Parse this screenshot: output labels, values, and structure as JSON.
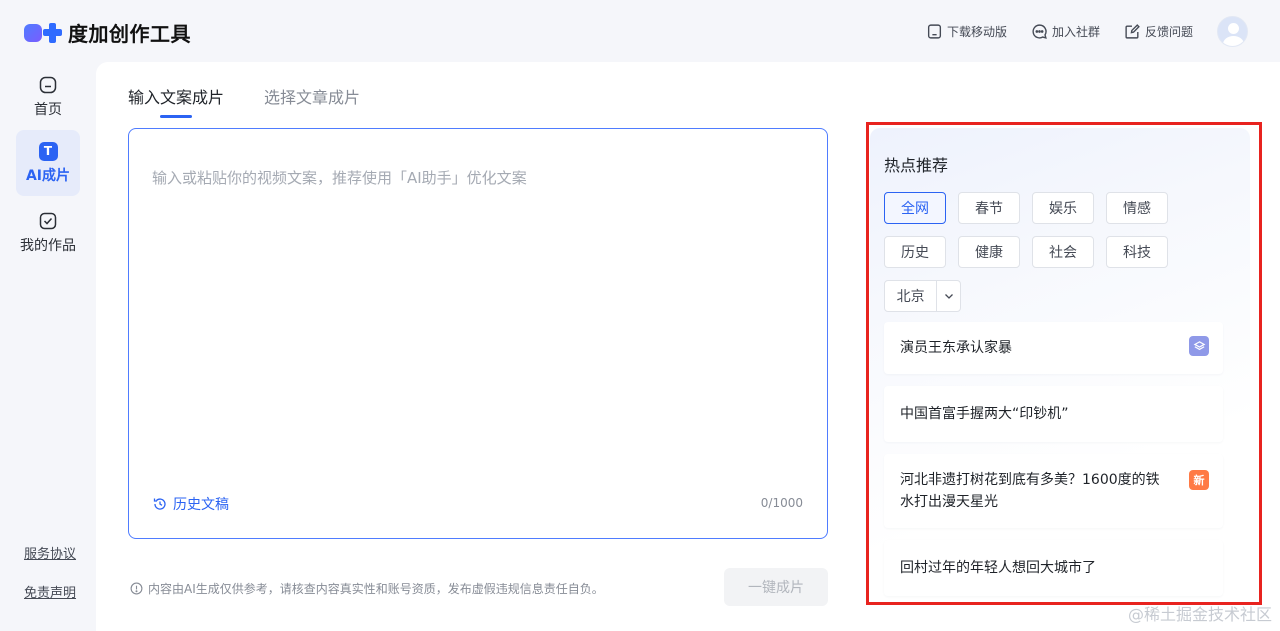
{
  "app": {
    "title": "度加创作工具"
  },
  "header": {
    "actions": [
      {
        "label": "下载移动版",
        "icon": "mobile-icon"
      },
      {
        "label": "加入社群",
        "icon": "chat-icon"
      },
      {
        "label": "反馈问题",
        "icon": "edit-icon"
      }
    ],
    "avatar": "avatar-icon"
  },
  "sidebar": {
    "items": [
      {
        "label": "首页",
        "icon": "home-icon"
      },
      {
        "label": "AI成片",
        "icon": "ai-icon",
        "active": true,
        "icon_text": "T"
      },
      {
        "label": "我的作品",
        "icon": "check-icon"
      }
    ],
    "links": {
      "terms": "服务协议",
      "disclaimer": "免责声明"
    }
  },
  "main": {
    "tabs": [
      {
        "label": "输入文案成片",
        "active": true
      },
      {
        "label": "选择文章成片",
        "active": false
      }
    ],
    "editor": {
      "placeholder": "输入或粘贴你的视频文案，推荐使用「AI助手」优化文案",
      "value": "",
      "history_label": "历史文稿",
      "counter": "0/1000"
    },
    "disclaimer": "内容由AI生成仅供参考，请核查内容真实性和账号资质，发布虚假违规信息责任自负。",
    "generate_button": "一键成片"
  },
  "hot": {
    "title": "热点推荐",
    "categories": [
      "全网",
      "春节",
      "娱乐",
      "情感",
      "历史",
      "健康",
      "社会",
      "科技"
    ],
    "active_category": "全网",
    "region": "北京",
    "items": [
      {
        "text": "演员王东承认家暴",
        "badge": "layer"
      },
      {
        "text": "中国首富手握两大“印钞机”",
        "badge": ""
      },
      {
        "text": "河北非遗打树花到底有多美？1600度的铁水打出漫天星光",
        "badge": "新"
      },
      {
        "text": "回村过年的年轻人想回大城市了",
        "badge": ""
      }
    ]
  },
  "watermark": "@稀土掘金技术社区",
  "colors": {
    "accent": "#2b63f3",
    "highlight_border": "#e8231f",
    "new_badge": "#ff7a45"
  }
}
